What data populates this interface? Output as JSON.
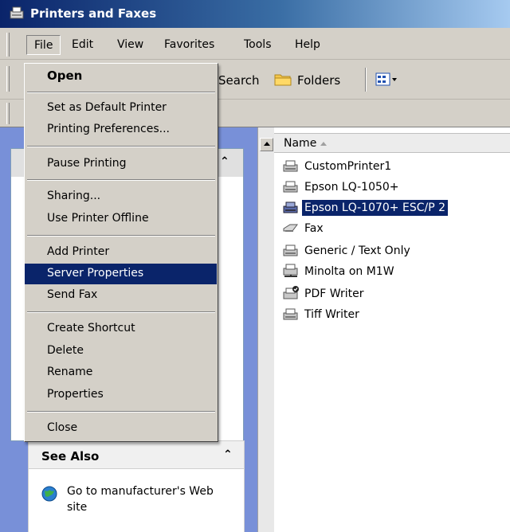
{
  "window": {
    "title": "Printers and Faxes"
  },
  "menubar": {
    "items": [
      "File",
      "Edit",
      "View",
      "Favorites",
      "Tools",
      "Help"
    ]
  },
  "toolbar": {
    "search_label": "Search",
    "folders_label": "Folders"
  },
  "file_menu": {
    "items": [
      {
        "label": "Open",
        "bold": true
      },
      {
        "label": "Set as Default Printer"
      },
      {
        "label": "Printing Preferences..."
      },
      {
        "label": "Pause Printing"
      },
      {
        "label": "Sharing..."
      },
      {
        "label": "Use Printer Offline"
      },
      {
        "label": "Add Printer"
      },
      {
        "label": "Server Properties",
        "highlighted": true
      },
      {
        "label": "Send Fax"
      },
      {
        "label": "Create Shortcut"
      },
      {
        "label": "Delete"
      },
      {
        "label": "Rename"
      },
      {
        "label": "Properties"
      },
      {
        "label": "Close"
      }
    ]
  },
  "see_also": {
    "title": "See Also",
    "link": "Go to manufacturer's Web site"
  },
  "list": {
    "column": "Name",
    "items": [
      {
        "name": "CustomPrinter1"
      },
      {
        "name": "Epson LQ-1050+"
      },
      {
        "name": "Epson LQ-1070+ ESC/P 2",
        "selected": true
      },
      {
        "name": "Fax"
      },
      {
        "name": "Generic / Text Only"
      },
      {
        "name": "Minolta on M1W"
      },
      {
        "name": "PDF Writer"
      },
      {
        "name": "Tiff Writer"
      }
    ]
  },
  "colors": {
    "selection": "#0a246a",
    "chrome": "#d4d0c8",
    "taskpane": "#7890d8"
  }
}
